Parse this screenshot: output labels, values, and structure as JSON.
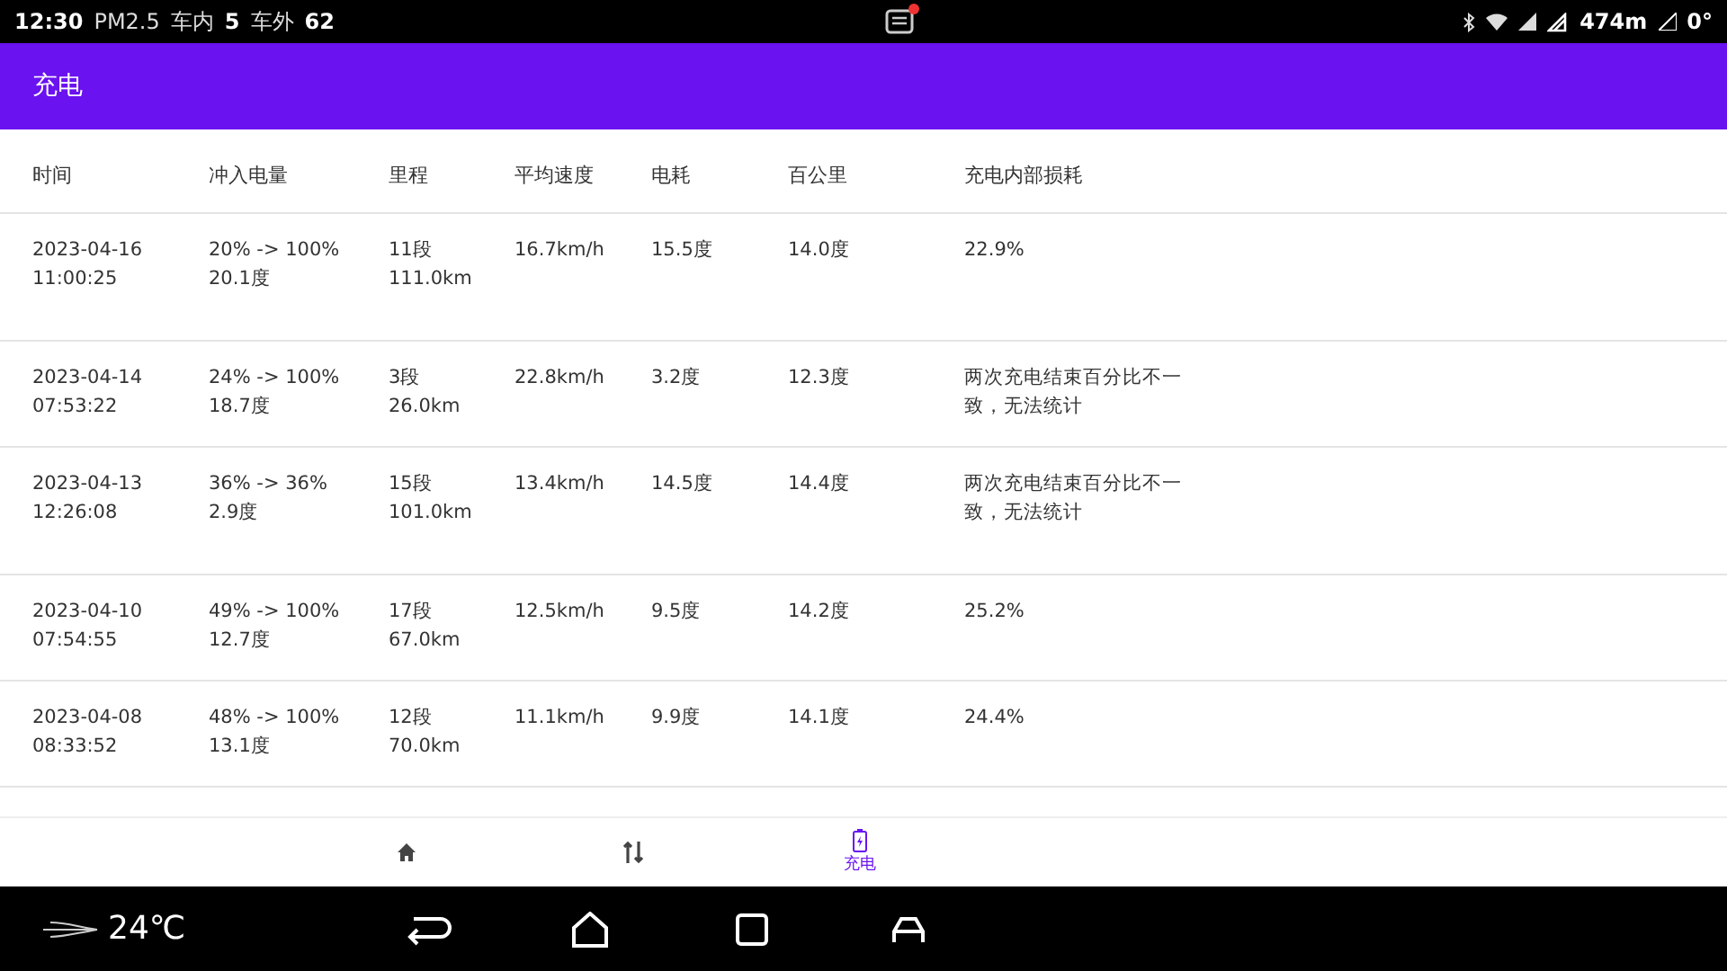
{
  "status_bar": {
    "time": "12:30",
    "air_label": "PM2.5",
    "inside_label": "车内",
    "inside_value": "5",
    "outside_label": "车外",
    "outside_value": "62",
    "altitude": "474m",
    "angle": "0°"
  },
  "app_bar": {
    "title": "充电"
  },
  "table": {
    "columns": [
      "时间",
      "冲入电量",
      "里程",
      "平均速度",
      "电耗",
      "百公里",
      "充电内部损耗"
    ],
    "rows": [
      {
        "time": [
          "2023-04-16",
          "11:00:25"
        ],
        "charge": [
          "20% -> 100%",
          "20.1度"
        ],
        "range": [
          "11段",
          "111.0km"
        ],
        "speed": "16.7km/h",
        "energy": "15.5度",
        "per100": "14.0度",
        "loss": "22.9%"
      },
      {
        "time": [
          "2023-04-14",
          "07:53:22"
        ],
        "charge": [
          "24% -> 100%",
          "18.7度"
        ],
        "range": [
          "3段",
          "26.0km"
        ],
        "speed": "22.8km/h",
        "energy": "3.2度",
        "per100": "12.3度",
        "loss": "两次充电结束百分比不一致，无法统计"
      },
      {
        "time": [
          "2023-04-13",
          "12:26:08"
        ],
        "charge": [
          "36% -> 36%",
          "2.9度"
        ],
        "range": [
          "15段",
          "101.0km"
        ],
        "speed": "13.4km/h",
        "energy": "14.5度",
        "per100": "14.4度",
        "loss": "两次充电结束百分比不一致，无法统计"
      },
      {
        "time": [
          "2023-04-10",
          "07:54:55"
        ],
        "charge": [
          "49% -> 100%",
          "12.7度"
        ],
        "range": [
          "17段",
          "67.0km"
        ],
        "speed": "12.5km/h",
        "energy": "9.5度",
        "per100": "14.2度",
        "loss": "25.2%"
      },
      {
        "time": [
          "2023-04-08",
          "08:33:52"
        ],
        "charge": [
          "48% -> 100%",
          "13.1度"
        ],
        "range": [
          "12段",
          "70.0km"
        ],
        "speed": "11.1km/h",
        "energy": "9.9度",
        "per100": "14.1度",
        "loss": "24.4%"
      }
    ]
  },
  "bottom_tabs": [
    {
      "kind": "home",
      "selected": false
    },
    {
      "kind": "swap",
      "selected": false
    },
    {
      "kind": "charge",
      "label": "充电",
      "selected": true
    }
  ],
  "system_bar": {
    "temperature": "24℃"
  }
}
